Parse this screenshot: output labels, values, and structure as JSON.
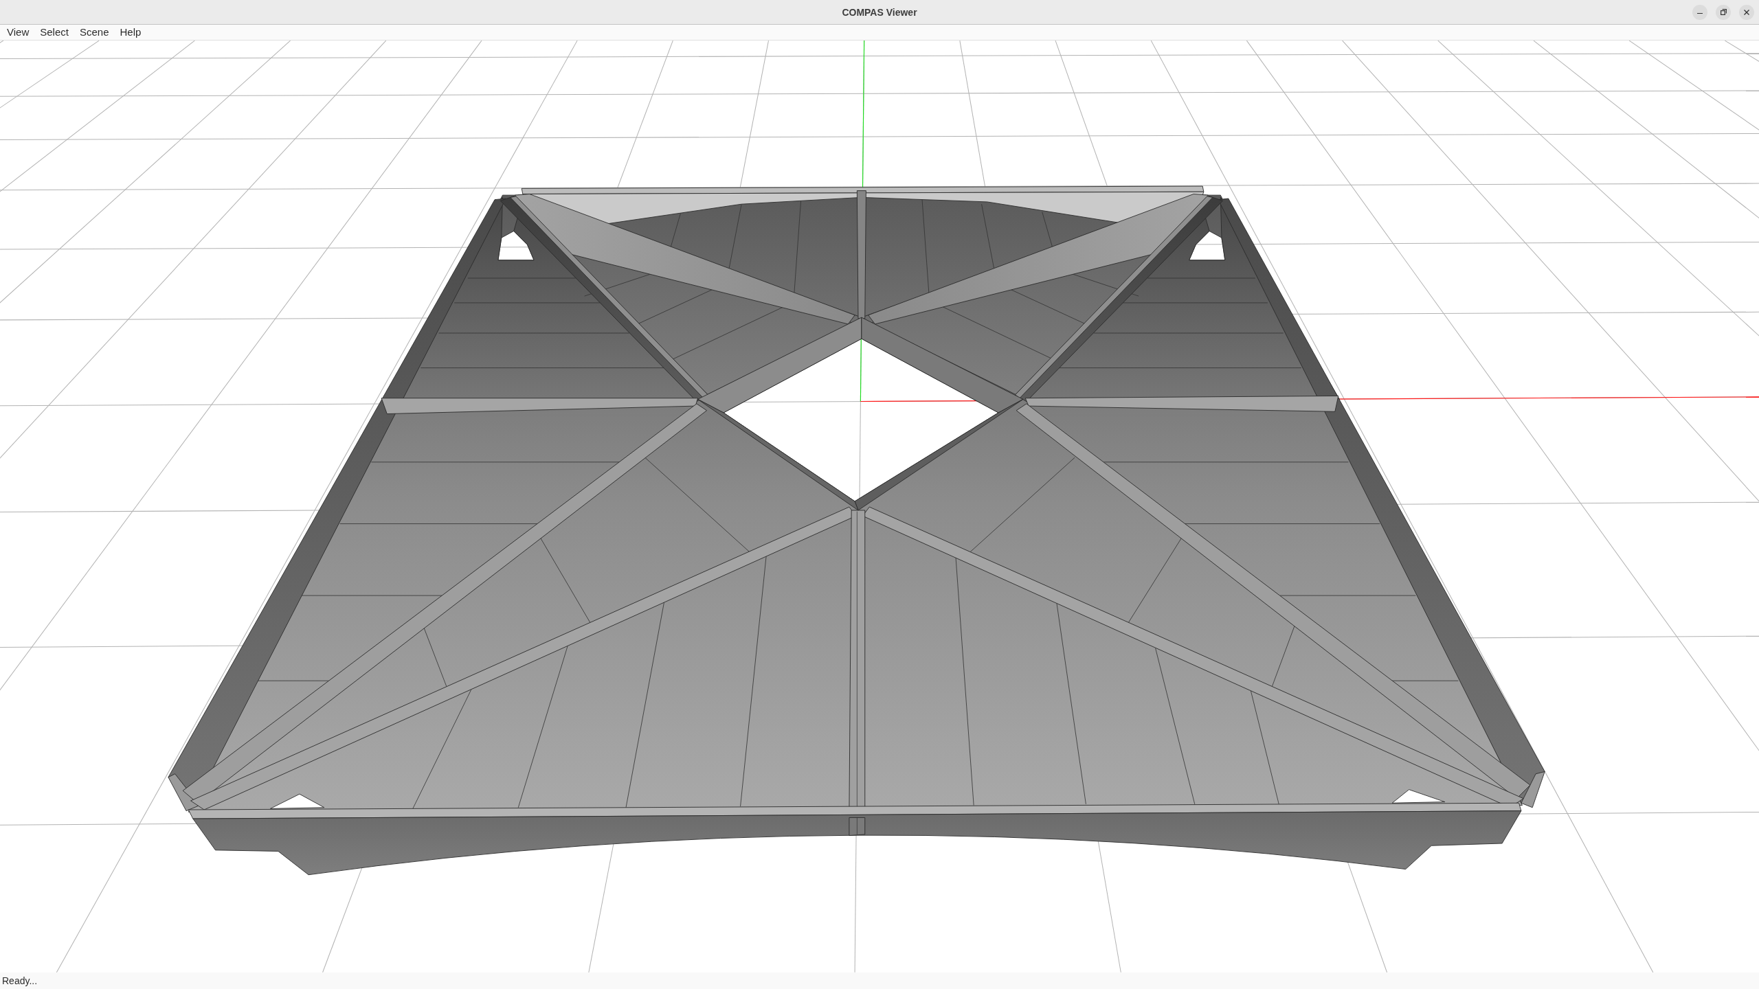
{
  "window": {
    "title": "COMPAS Viewer"
  },
  "menu_bar": {
    "items": [
      {
        "label": "View"
      },
      {
        "label": "Select"
      },
      {
        "label": "Scene"
      },
      {
        "label": "Help"
      }
    ]
  },
  "status_bar": {
    "text": "Ready..."
  }
}
